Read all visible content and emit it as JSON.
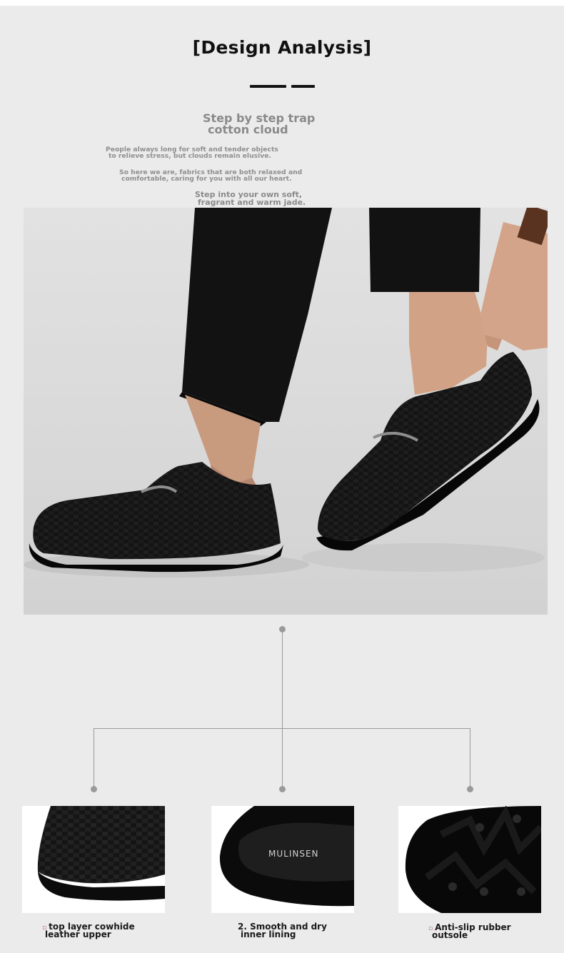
{
  "header": {
    "title": "[Design Analysis]",
    "subtitle_line1": "Step by step trap",
    "subtitle_line2": "cotton cloud"
  },
  "intro": {
    "p1_line1": "People always long for soft and tender objects",
    "p1_line2": "to relieve stress, but clouds remain elusive.",
    "p2_line1": "So here we are, fabrics that are both relaxed and",
    "p2_line2": "comfortable, caring for you with all our heart.",
    "p3_line1": "Step into your own soft,",
    "p3_line2": "fragrant and warm jade."
  },
  "features": [
    {
      "icon": "bullet-icon",
      "line1": "top layer cowhide",
      "line2": "leather upper"
    },
    {
      "line1": "2. Smooth and dry",
      "line2": "inner lining",
      "insole_brand": "MULINSEN"
    },
    {
      "icon": "bullet-icon",
      "line1": "Anti-slip rubber",
      "line2": "outsole"
    }
  ],
  "colors": {
    "background": "#ebebeb",
    "shoe": "#111111",
    "connector": "#9a9a9a"
  }
}
